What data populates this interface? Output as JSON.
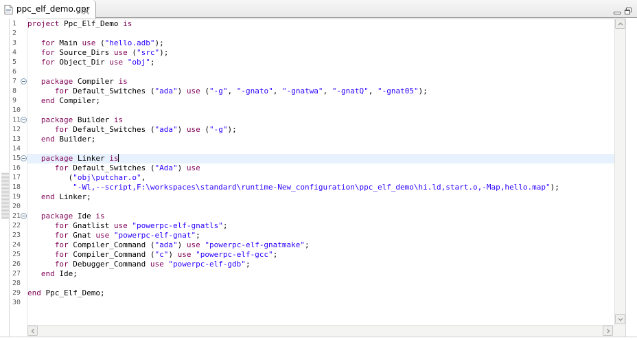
{
  "tab": {
    "title": "ppc_elf_demo.gpr"
  },
  "editor": {
    "current_line": 15,
    "lines": [
      {
        "n": "1",
        "fold": false,
        "tokens": [
          [
            "kw",
            "project"
          ],
          [
            "t",
            " Ppc_Elf_Demo "
          ],
          [
            "kw",
            "is"
          ]
        ]
      },
      {
        "n": "2",
        "fold": false,
        "tokens": []
      },
      {
        "n": "3",
        "fold": false,
        "tokens": [
          [
            "t",
            "   "
          ],
          [
            "kw",
            "for"
          ],
          [
            "t",
            " Main "
          ],
          [
            "kw",
            "use"
          ],
          [
            "t",
            " ("
          ],
          [
            "str",
            "\"hello.adb\""
          ],
          [
            "t",
            ");"
          ]
        ]
      },
      {
        "n": "4",
        "fold": false,
        "tokens": [
          [
            "t",
            "   "
          ],
          [
            "kw",
            "for"
          ],
          [
            "t",
            " Source_Dirs "
          ],
          [
            "kw",
            "use"
          ],
          [
            "t",
            " ("
          ],
          [
            "str",
            "\"src\""
          ],
          [
            "t",
            ");"
          ]
        ]
      },
      {
        "n": "5",
        "fold": false,
        "tokens": [
          [
            "t",
            "   "
          ],
          [
            "kw",
            "for"
          ],
          [
            "t",
            " Object_Dir "
          ],
          [
            "kw",
            "use"
          ],
          [
            "t",
            " "
          ],
          [
            "str",
            "\"obj\""
          ],
          [
            "t",
            ";"
          ]
        ]
      },
      {
        "n": "6",
        "fold": false,
        "tokens": []
      },
      {
        "n": "7",
        "fold": true,
        "tokens": [
          [
            "t",
            "   "
          ],
          [
            "kw",
            "package"
          ],
          [
            "t",
            " Compiler "
          ],
          [
            "kw",
            "is"
          ]
        ]
      },
      {
        "n": "8",
        "fold": false,
        "tokens": [
          [
            "t",
            "      "
          ],
          [
            "kw",
            "for"
          ],
          [
            "t",
            " Default_Switches ("
          ],
          [
            "str",
            "\"ada\""
          ],
          [
            "t",
            ") "
          ],
          [
            "kw",
            "use"
          ],
          [
            "t",
            " ("
          ],
          [
            "str",
            "\"-g\""
          ],
          [
            "t",
            ", "
          ],
          [
            "str",
            "\"-gnato\""
          ],
          [
            "t",
            ", "
          ],
          [
            "str",
            "\"-gnatwa\""
          ],
          [
            "t",
            ", "
          ],
          [
            "str",
            "\"-gnatQ\""
          ],
          [
            "t",
            ", "
          ],
          [
            "str",
            "\"-gnat05\""
          ],
          [
            "t",
            ");"
          ]
        ]
      },
      {
        "n": "9",
        "fold": false,
        "tokens": [
          [
            "t",
            "   "
          ],
          [
            "kw",
            "end"
          ],
          [
            "t",
            " Compiler;"
          ]
        ]
      },
      {
        "n": "10",
        "fold": false,
        "tokens": []
      },
      {
        "n": "11",
        "fold": true,
        "tokens": [
          [
            "t",
            "   "
          ],
          [
            "kw",
            "package"
          ],
          [
            "t",
            " Builder "
          ],
          [
            "kw",
            "is"
          ]
        ]
      },
      {
        "n": "12",
        "fold": false,
        "tokens": [
          [
            "t",
            "      "
          ],
          [
            "kw",
            "for"
          ],
          [
            "t",
            " Default_Switches ("
          ],
          [
            "str",
            "\"ada\""
          ],
          [
            "t",
            ") "
          ],
          [
            "kw",
            "use"
          ],
          [
            "t",
            " ("
          ],
          [
            "str",
            "\"-g\""
          ],
          [
            "t",
            ");"
          ]
        ]
      },
      {
        "n": "13",
        "fold": false,
        "tokens": [
          [
            "t",
            "   "
          ],
          [
            "kw",
            "end"
          ],
          [
            "t",
            " Builder;"
          ]
        ]
      },
      {
        "n": "14",
        "fold": false,
        "tokens": []
      },
      {
        "n": "15",
        "fold": true,
        "tokens": [
          [
            "t",
            "   "
          ],
          [
            "kw",
            "package"
          ],
          [
            "t",
            " Linker "
          ],
          [
            "kw",
            "is"
          ],
          [
            "caret",
            ""
          ]
        ]
      },
      {
        "n": "16",
        "fold": false,
        "tokens": [
          [
            "t",
            "      "
          ],
          [
            "kw",
            "for"
          ],
          [
            "t",
            " Default_Switches ("
          ],
          [
            "str",
            "\"Ada\""
          ],
          [
            "t",
            ") "
          ],
          [
            "kw",
            "use"
          ]
        ]
      },
      {
        "n": "17",
        "fold": false,
        "tokens": [
          [
            "t",
            "         ("
          ],
          [
            "str",
            "\"obj\\putchar.o\""
          ],
          [
            "t",
            ","
          ]
        ]
      },
      {
        "n": "18",
        "fold": false,
        "tokens": [
          [
            "t",
            "          "
          ],
          [
            "str",
            "\"-Wl,--script,F:\\workspaces\\standard\\runtime-New_configuration\\ppc_elf_demo\\hi.ld,start.o,-Map,hello.map\""
          ],
          [
            "t",
            ");"
          ]
        ]
      },
      {
        "n": "19",
        "fold": false,
        "tokens": [
          [
            "t",
            "   "
          ],
          [
            "kw",
            "end"
          ],
          [
            "t",
            " Linker;"
          ]
        ]
      },
      {
        "n": "20",
        "fold": false,
        "tokens": []
      },
      {
        "n": "21",
        "fold": true,
        "tokens": [
          [
            "t",
            "   "
          ],
          [
            "kw",
            "package"
          ],
          [
            "t",
            " Ide "
          ],
          [
            "kw",
            "is"
          ]
        ]
      },
      {
        "n": "22",
        "fold": false,
        "tokens": [
          [
            "t",
            "      "
          ],
          [
            "kw",
            "for"
          ],
          [
            "t",
            " Gnatlist "
          ],
          [
            "kw",
            "use"
          ],
          [
            "t",
            " "
          ],
          [
            "str",
            "\"powerpc-elf-gnatls\""
          ],
          [
            "t",
            ";"
          ]
        ]
      },
      {
        "n": "23",
        "fold": false,
        "tokens": [
          [
            "t",
            "      "
          ],
          [
            "kw",
            "for"
          ],
          [
            "t",
            " Gnat "
          ],
          [
            "kw",
            "use"
          ],
          [
            "t",
            " "
          ],
          [
            "str",
            "\"powerpc-elf-gnat\""
          ],
          [
            "t",
            ";"
          ]
        ]
      },
      {
        "n": "24",
        "fold": false,
        "tokens": [
          [
            "t",
            "      "
          ],
          [
            "kw",
            "for"
          ],
          [
            "t",
            " Compiler_Command ("
          ],
          [
            "str",
            "\"ada\""
          ],
          [
            "t",
            ") "
          ],
          [
            "kw",
            "use"
          ],
          [
            "t",
            " "
          ],
          [
            "str",
            "\"powerpc-elf-gnatmake\""
          ],
          [
            "t",
            ";"
          ]
        ]
      },
      {
        "n": "25",
        "fold": false,
        "tokens": [
          [
            "t",
            "      "
          ],
          [
            "kw",
            "for"
          ],
          [
            "t",
            " Compiler_Command ("
          ],
          [
            "str",
            "\"c\""
          ],
          [
            "t",
            ") "
          ],
          [
            "kw",
            "use"
          ],
          [
            "t",
            " "
          ],
          [
            "str",
            "\"powerpc-elf-gcc\""
          ],
          [
            "t",
            ";"
          ]
        ]
      },
      {
        "n": "26",
        "fold": false,
        "tokens": [
          [
            "t",
            "      "
          ],
          [
            "kw",
            "for"
          ],
          [
            "t",
            " Debugger_Command "
          ],
          [
            "kw",
            "use"
          ],
          [
            "t",
            " "
          ],
          [
            "str",
            "\"powerpc-elf-gdb\""
          ],
          [
            "t",
            ";"
          ]
        ]
      },
      {
        "n": "27",
        "fold": false,
        "tokens": [
          [
            "t",
            "   "
          ],
          [
            "kw",
            "end"
          ],
          [
            "t",
            " Ide;"
          ]
        ]
      },
      {
        "n": "28",
        "fold": false,
        "tokens": []
      },
      {
        "n": "29",
        "fold": false,
        "tokens": [
          [
            "kw",
            "end"
          ],
          [
            "t",
            " Ppc_Elf_Demo;"
          ]
        ]
      },
      {
        "n": "30",
        "fold": false,
        "tokens": []
      }
    ]
  },
  "colors": {
    "keyword": "#7f0055",
    "string": "#2a00ff",
    "current_line": "#e8f2fe"
  },
  "icons": {
    "tab": "file-icon",
    "tab_close": "close-icon",
    "minimize": "minimize-icon",
    "restore": "restore-icon",
    "fold": "collapse-icon"
  }
}
